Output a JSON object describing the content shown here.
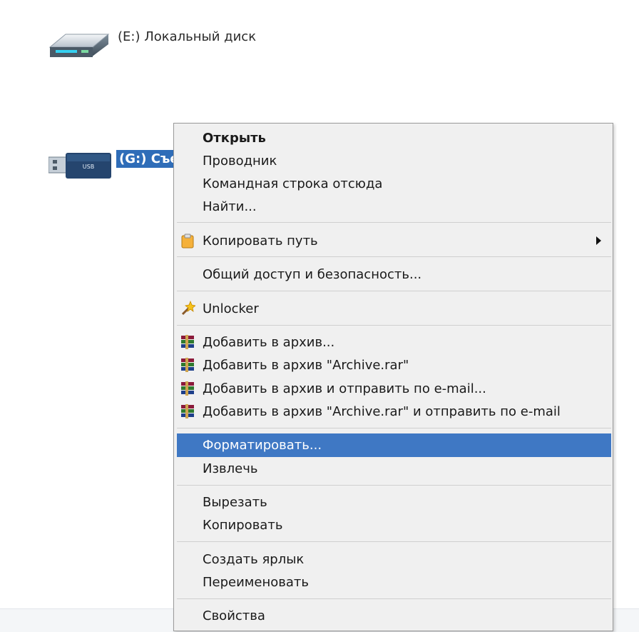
{
  "drives": {
    "e_label": "(E:) Локальный диск",
    "g_label": "(G:) Съе",
    "e_icon": "hard-drive-icon",
    "g_icon": "usb-drive-icon"
  },
  "menu": {
    "items": {
      "open": "Открыть",
      "explorer": "Проводник",
      "cmd_here": "Командная строка отсюда",
      "find": "Найти...",
      "copy_path": "Копировать путь",
      "sharing": "Общий доступ и безопасность...",
      "unlocker": "Unlocker",
      "add_archive": "Добавить в архив...",
      "add_archive_rar": "Добавить в архив \"Archive.rar\"",
      "add_archive_email": "Добавить в архив и отправить по e-mail...",
      "add_archive_rar_email": "Добавить в архив \"Archive.rar\" и отправить по e-mail",
      "format": "Форматировать...",
      "eject": "Извлечь",
      "cut": "Вырезать",
      "copy": "Копировать",
      "create_shortcut": "Создать ярлык",
      "rename": "Переименовать",
      "properties": "Свойства"
    },
    "highlight_color": "#3f78c4",
    "icons": {
      "copy_path": "clipboard-icon",
      "unlocker": "magic-wand-icon",
      "winrar": "winrar-books-icon"
    }
  }
}
